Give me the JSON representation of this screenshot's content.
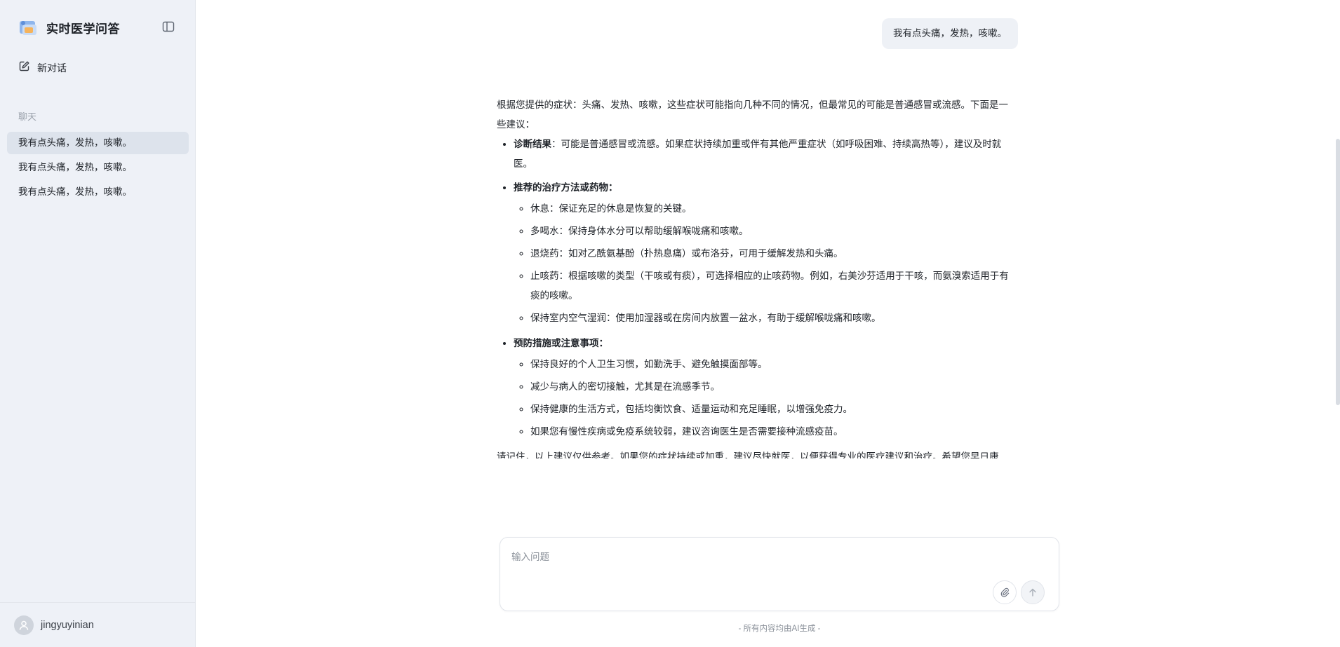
{
  "sidebar": {
    "app_title": "实时医学问答",
    "new_chat_label": "新对话",
    "section_label": "聊天",
    "history": [
      {
        "label": "我有点头痛，发热，咳嗽。",
        "active": true
      },
      {
        "label": "我有点头痛，发热，咳嗽。",
        "active": false
      },
      {
        "label": "我有点头痛，发热，咳嗽。",
        "active": false
      }
    ],
    "username": "jingyuyinian"
  },
  "chat": {
    "user_message": "我有点头痛，发热，咳嗽。",
    "answer": {
      "intro": "根据您提供的症状：头痛、发热、咳嗽，这些症状可能指向几种不同的情况，但最常见的可能是普通感冒或流感。下面是一些建议：",
      "diagnosis": {
        "label": "诊断结果",
        "text": "：可能是普通感冒或流感。如果症状持续加重或伴有其他严重症状（如呼吸困难、持续高热等），建议及时就医。"
      },
      "treatment": {
        "label": "推荐的治疗方法或药物",
        "colon": "：",
        "items": [
          "休息：保证充足的休息是恢复的关键。",
          "多喝水：保持身体水分可以帮助缓解喉咙痛和咳嗽。",
          "退烧药：如对乙酰氨基酚（扑热息痛）或布洛芬，可用于缓解发热和头痛。",
          "止咳药：根据咳嗽的类型（干咳或有痰），可选择相应的止咳药物。例如，右美沙芬适用于干咳，而氨溴索适用于有痰的咳嗽。",
          "保持室内空气湿润：使用加湿器或在房间内放置一盆水，有助于缓解喉咙痛和咳嗽。"
        ]
      },
      "prevention": {
        "label": "预防措施或注意事项",
        "colon": "：",
        "items": [
          "保持良好的个人卫生习惯，如勤洗手、避免触摸面部等。",
          "减少与病人的密切接触，尤其是在流感季节。",
          "保持健康的生活方式，包括均衡饮食、适量运动和充足睡眠，以增强免疫力。",
          "如果您有慢性疾病或免疫系统较弱，建议咨询医生是否需要接种流感疫苗。"
        ]
      },
      "closing": "请记住，以上建议仅供参考。如果您的症状持续或加重，建议尽快就医，以便获得专业的医疗建议和治疗。希望您早日康复！"
    }
  },
  "input": {
    "placeholder": "输入问题",
    "value": ""
  },
  "footer_note": "- 所有内容均由AI生成 -",
  "colors": {
    "sidebar_bg": "#eef1f7",
    "active_item_bg": "#dde3ec",
    "bubble_bg": "#eef1f6"
  }
}
